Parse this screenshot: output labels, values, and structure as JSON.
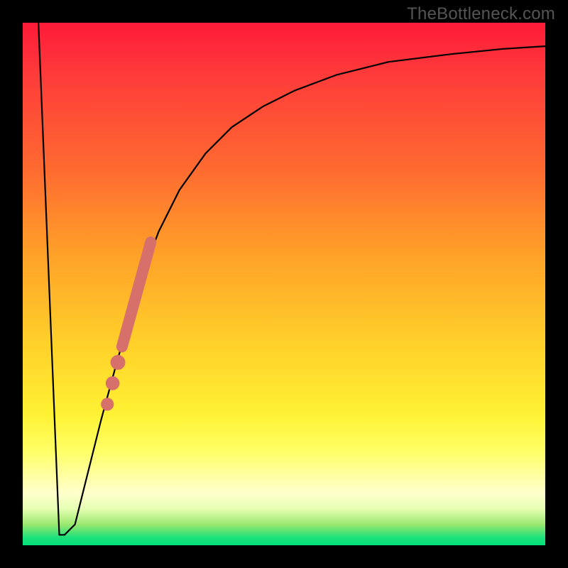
{
  "watermark": "TheBottleneck.com",
  "chart_data": {
    "type": "line",
    "title": "",
    "xlabel": "",
    "ylabel": "",
    "xlim": [
      0,
      100
    ],
    "ylim": [
      0,
      100
    ],
    "grid": false,
    "legend": false,
    "series": [
      {
        "name": "curve",
        "x": [
          3,
          7,
          8,
          10,
          12,
          15,
          18,
          20,
          23,
          26,
          30,
          35,
          40,
          46,
          52,
          60,
          70,
          82,
          92,
          100
        ],
        "y": [
          100,
          2,
          2,
          4,
          12,
          24,
          35,
          42,
          52,
          60,
          68,
          75,
          80,
          84,
          87,
          90,
          92.5,
          94,
          95,
          95.5
        ]
      }
    ],
    "markers": [
      {
        "name": "marker-segment",
        "x_range": [
          19,
          24.5
        ],
        "y_range": [
          38,
          58
        ],
        "color": "#d76f6a",
        "style": "thick-line"
      },
      {
        "name": "marker-dot-1",
        "x": 18.2,
        "y": 35,
        "r": 1.5,
        "color": "#d76f6a"
      },
      {
        "name": "marker-dot-2",
        "x": 17.2,
        "y": 31,
        "r": 1.4,
        "color": "#d76f6a"
      },
      {
        "name": "marker-dot-3",
        "x": 16.2,
        "y": 27,
        "r": 1.3,
        "color": "#d76f6a"
      }
    ],
    "colors": {
      "curve": "#000000",
      "marker": "#d76f6a",
      "gradient_top": "#ff1a39",
      "gradient_mid": "#ffd22a",
      "gradient_bottom": "#00e07a",
      "frame": "#000000"
    }
  }
}
